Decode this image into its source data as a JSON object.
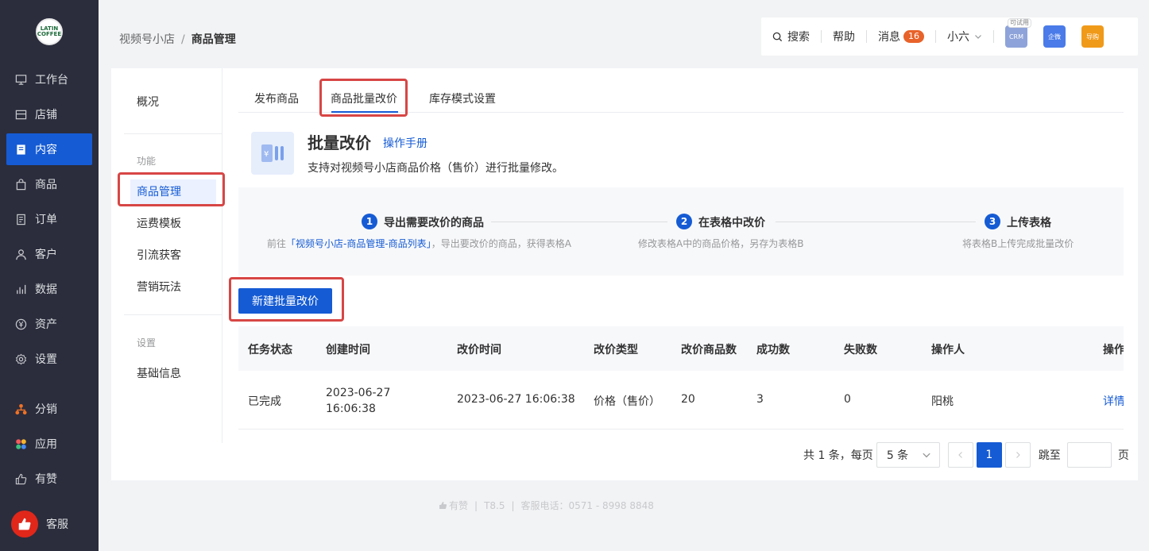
{
  "nav": {
    "logo_text": "LATIN COFFEE",
    "items": [
      {
        "label": "工作台",
        "icon": "monitor-icon"
      },
      {
        "label": "店铺",
        "icon": "store-icon"
      },
      {
        "label": "内容",
        "icon": "document-icon"
      },
      {
        "label": "商品",
        "icon": "bag-icon"
      },
      {
        "label": "订单",
        "icon": "order-icon"
      },
      {
        "label": "客户",
        "icon": "user-icon"
      },
      {
        "label": "数据",
        "icon": "chart-icon"
      },
      {
        "label": "资产",
        "icon": "yuan-icon"
      },
      {
        "label": "设置",
        "icon": "gear-icon"
      },
      {
        "label": "分销",
        "icon": "distribution-icon"
      },
      {
        "label": "应用",
        "icon": "apps-icon"
      },
      {
        "label": "有赞",
        "icon": "thumb-icon"
      }
    ],
    "service_label": "客服"
  },
  "breadcrumb": {
    "parent": "视频号小店",
    "separator": "/",
    "current": "商品管理"
  },
  "topbar": {
    "search": "搜索",
    "help": "帮助",
    "messages": "消息",
    "message_count": "16",
    "user": "小六",
    "apps": [
      {
        "label": "CRM",
        "tag": "可试用",
        "color": "#8ea3d9"
      },
      {
        "label": "企微",
        "tag": "",
        "color": "#4a7be8"
      },
      {
        "label": "导购",
        "tag": "",
        "color": "#f09a1a"
      }
    ]
  },
  "subnav": {
    "overview": "概况",
    "group_function": "功能",
    "items": [
      "商品管理",
      "运费模板",
      "引流获客",
      "营销玩法"
    ],
    "group_settings": "设置",
    "settings_items": [
      "基础信息"
    ]
  },
  "tabs": [
    "发布商品",
    "商品批量改价",
    "库存模式设置"
  ],
  "intro": {
    "title": "批量改价",
    "manual_link": "操作手册",
    "description": "支持对视频号小店商品价格（售价）进行批量修改。"
  },
  "steps": [
    {
      "num": "1",
      "title": "导出需要改价的商品",
      "desc_prefix": "前往",
      "desc_link": "「视频号小店-商品管理-商品列表」",
      "desc_suffix": "，导出要改价的商品，获得表格A"
    },
    {
      "num": "2",
      "title": "在表格中改价",
      "desc": "修改表格A中的商品价格，另存为表格B"
    },
    {
      "num": "3",
      "title": "上传表格",
      "desc": "将表格B上传完成批量改价"
    }
  ],
  "new_button": "新建批量改价",
  "table": {
    "columns": [
      "任务状态",
      "创建时间",
      "改价时间",
      "改价类型",
      "改价商品数",
      "成功数",
      "失败数",
      "操作人",
      "操作"
    ],
    "rows": [
      {
        "status": "已完成",
        "created_date": "2023-06-27",
        "created_time": "16:06:38",
        "changed": "2023-06-27 16:06:38",
        "type": "价格（售价）",
        "count": "20",
        "success": "3",
        "fail": "0",
        "operator": "阳桃",
        "action": "详情"
      }
    ]
  },
  "pagination": {
    "summary": "共 1 条，每页",
    "page_size": "5 条",
    "current": "1",
    "jump_label": "跳至",
    "page_unit": "页"
  },
  "footer": {
    "brand": "有赞",
    "version": "T8.5",
    "hotline": "客服电话：0571 - 8998 8848"
  }
}
